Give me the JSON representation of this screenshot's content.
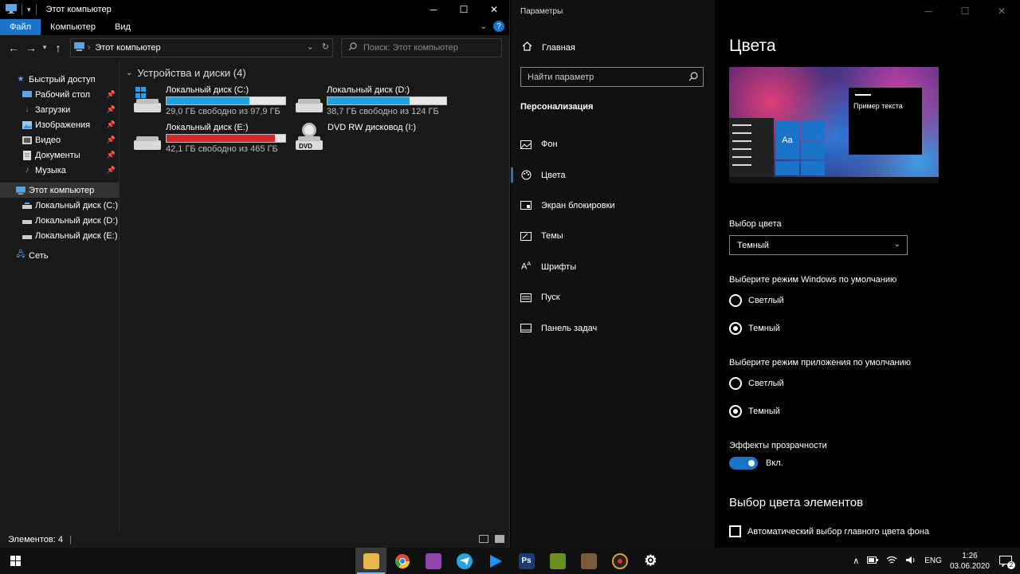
{
  "explorer": {
    "title": "Этот компьютер",
    "ribbon_tabs": [
      "Файл",
      "Компьютер",
      "Вид"
    ],
    "address": "Этот компьютер",
    "search_placeholder": "Поиск: Этот компьютер",
    "nav": {
      "quick_access": "Быстрый доступ",
      "quick_items": [
        {
          "label": "Рабочий стол",
          "icon": "desktop-icon"
        },
        {
          "label": "Загрузки",
          "icon": "download-icon"
        },
        {
          "label": "Изображения",
          "icon": "pictures-icon"
        },
        {
          "label": "Видео",
          "icon": "video-icon"
        },
        {
          "label": "Документы",
          "icon": "documents-icon"
        },
        {
          "label": "Музыка",
          "icon": "music-icon"
        }
      ],
      "this_pc": "Этот компьютер",
      "drives": [
        "Локальный диск (C:)",
        "Локальный диск (D:)",
        "Локальный диск (E:)"
      ],
      "network": "Сеть"
    },
    "group_title": "Устройства и диски (4)",
    "drives": [
      {
        "name": "Локальный диск (C:)",
        "free": "29,0 ГБ свободно из 97,9 ГБ",
        "used_fraction": 0.7,
        "critical": false,
        "type": "system"
      },
      {
        "name": "Локальный диск (D:)",
        "free": "38,7 ГБ свободно из 124 ГБ",
        "used_fraction": 0.69,
        "critical": false,
        "type": "hdd"
      },
      {
        "name": "Локальный диск (E:)",
        "free": "42,1 ГБ свободно из 465 ГБ",
        "used_fraction": 0.91,
        "critical": true,
        "type": "hdd"
      },
      {
        "name": "DVD RW дисковод (I:)",
        "free": "",
        "used_fraction": null,
        "critical": false,
        "type": "dvd",
        "badge": "DVD"
      }
    ],
    "status": "Элементов: 4"
  },
  "settings": {
    "window_title": "Параметры",
    "home": "Главная",
    "search_placeholder": "Найти параметр",
    "section": "Персонализация",
    "nav_items": [
      {
        "label": "Фон",
        "icon": "picture-icon"
      },
      {
        "label": "Цвета",
        "icon": "palette-icon",
        "active": true
      },
      {
        "label": "Экран блокировки",
        "icon": "lock-screen-icon"
      },
      {
        "label": "Темы",
        "icon": "themes-icon"
      },
      {
        "label": "Шрифты",
        "icon": "fonts-icon"
      },
      {
        "label": "Пуск",
        "icon": "start-icon"
      },
      {
        "label": "Панель задач",
        "icon": "taskbar-icon"
      }
    ],
    "page_title": "Цвета",
    "preview": {
      "sample_text": "Пример текста",
      "tile_label": "Aa"
    },
    "color_choice_label": "Выбор цвета",
    "color_choice_value": "Темный",
    "windows_mode_label": "Выберите режим Windows по умолчанию",
    "app_mode_label": "Выберите режим приложения по умолчанию",
    "light": "Светлый",
    "dark": "Темный",
    "transparency_label": "Эффекты прозрачности",
    "transparency_value": "Вкл.",
    "accent_heading": "Выбор цвета элементов",
    "auto_accent_label": "Автоматический выбор главного цвета фона",
    "accent_color": "#1a74c9"
  },
  "taskbar": {
    "apps": [
      {
        "name": "file-explorer-icon",
        "color": "#e8b84a",
        "active": true
      },
      {
        "name": "chrome-icon",
        "color": "#dd4b39"
      },
      {
        "name": "screen-recorder-icon",
        "color": "#8e44ad"
      },
      {
        "name": "telegram-icon",
        "color": "#2aa3df"
      },
      {
        "name": "media-player-icon",
        "color": "#1e90ff"
      },
      {
        "name": "photoshop-icon",
        "color": "#1f3b6e",
        "text": "Ps"
      },
      {
        "name": "minecraft-icon",
        "color": "#6b8e23"
      },
      {
        "name": "minecraft-launcher-icon",
        "color": "#7a5c3a"
      },
      {
        "name": "music-player-icon",
        "color": "#333333"
      },
      {
        "name": "settings-gear-icon",
        "color": "#101010"
      }
    ],
    "lang": "ENG",
    "time": "1:26",
    "date": "03.06.2020",
    "notification_count": "2"
  }
}
